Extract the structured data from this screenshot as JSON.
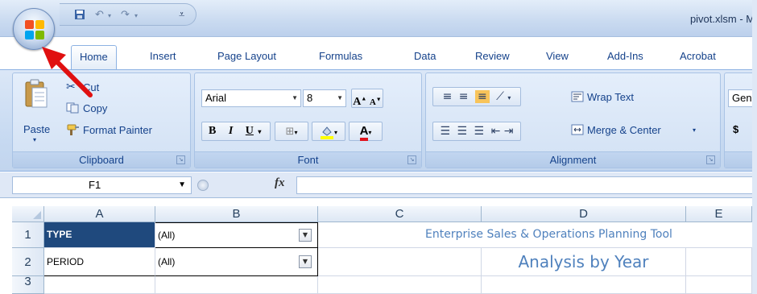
{
  "window": {
    "title": "pivot.xlsm - Mi"
  },
  "tabs": [
    "Home",
    "Insert",
    "Page Layout",
    "Formulas",
    "Data",
    "Review",
    "View",
    "Add-Ins",
    "Acrobat"
  ],
  "clipboard": {
    "paste": "Paste",
    "cut": "Cut",
    "copy": "Copy",
    "format_painter": "Format Painter",
    "label": "Clipboard"
  },
  "font": {
    "name": "Arial",
    "size": "8",
    "label": "Font",
    "bold": "B",
    "italic": "I",
    "underline": "U",
    "font_color": "#e0141e",
    "highlight_color": "#ffff00"
  },
  "alignment": {
    "wrap_text": "Wrap Text",
    "merge_center": "Merge & Center",
    "label": "Alignment"
  },
  "number": {
    "format": "Gene",
    "currency": "$"
  },
  "formula_bar": {
    "name_box": "F1",
    "fx": "fx",
    "formula": ""
  },
  "grid": {
    "columns": [
      "A",
      "B",
      "C",
      "D",
      "E"
    ],
    "rows": [
      "1",
      "2",
      "3"
    ],
    "cells": {
      "a1": "TYPE",
      "b1": "(All)",
      "a2": "PERIOD",
      "b2": "(All)",
      "title1": "Enterprise Sales & Operations Planning Tool",
      "title2": "Analysis by Year"
    },
    "header_fill": "#1f497d",
    "title_color": "#4f81bd"
  },
  "annotation": {
    "arrow_color": "#e01010"
  }
}
